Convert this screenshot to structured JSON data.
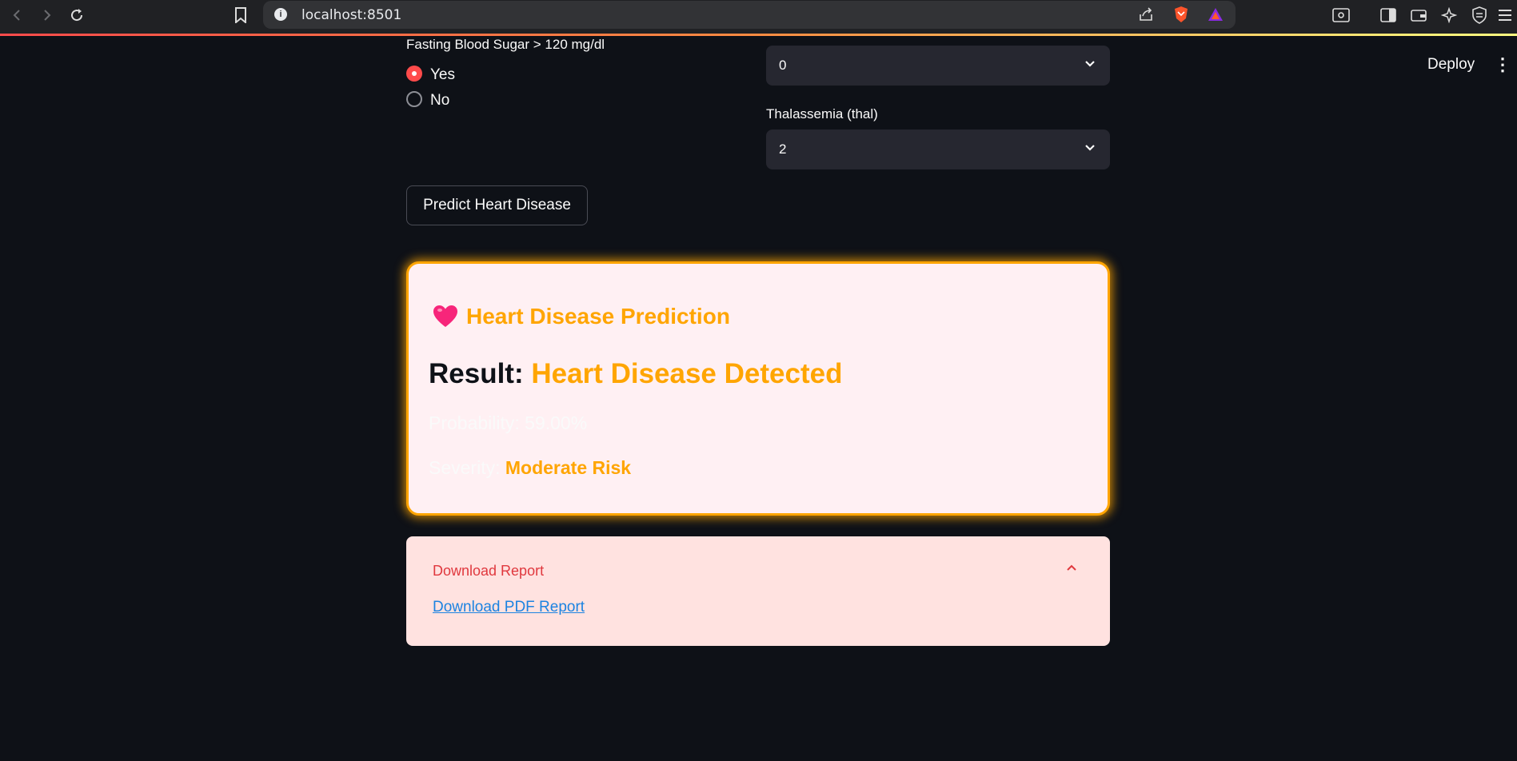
{
  "browser": {
    "url": "localhost:8501"
  },
  "header": {
    "deploy_label": "Deploy",
    "menu_glyph": "⋮"
  },
  "form": {
    "fbs_label": "Fasting Blood Sugar > 120 mg/dl",
    "fbs_options": [
      "Yes",
      "No"
    ],
    "fbs_selected": "Yes",
    "ca_selected": "0",
    "thal_label": "Thalassemia (thal)",
    "thal_selected": "2"
  },
  "predict_button": "Predict Heart Disease",
  "result_card": {
    "title": "Heart Disease Prediction",
    "result_prefix": "Result: ",
    "result_value": "Heart Disease Detected",
    "probability_text": "Probability: 59.00%",
    "severity_prefix": "Severity: ",
    "severity_value": "Moderate Risk"
  },
  "download": {
    "title": "Download Report",
    "link": "Download PDF Report"
  },
  "colors": {
    "accent": "#ffa500",
    "primary": "#ff4b4b",
    "background": "#0e1117",
    "link": "#1c83e1"
  }
}
